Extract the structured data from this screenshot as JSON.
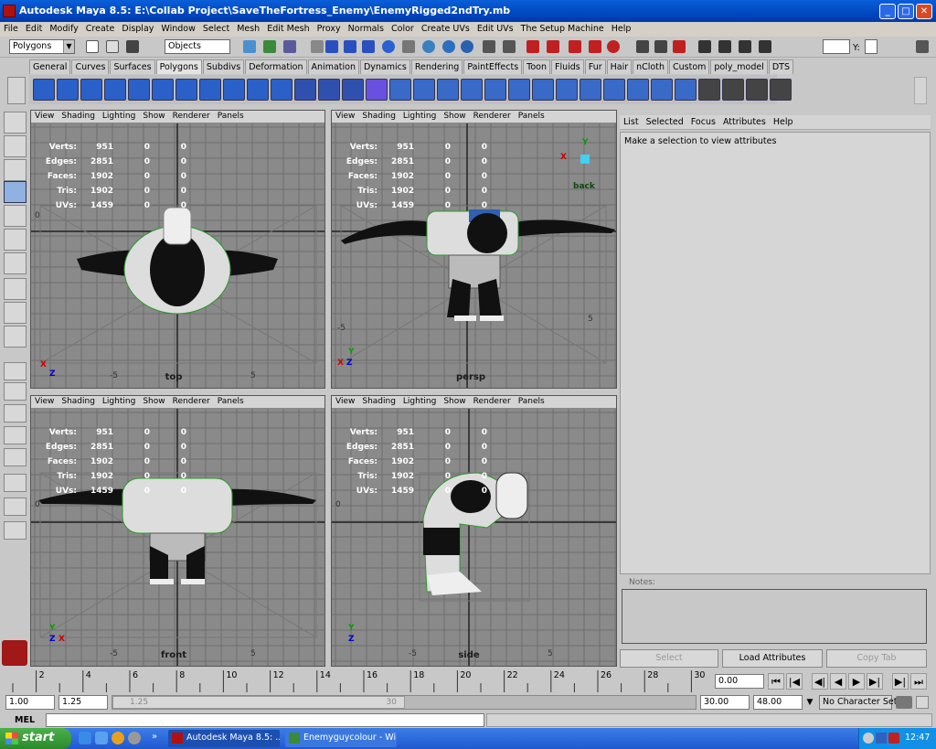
{
  "window": {
    "title": "Autodesk Maya 8.5: E:\\Collab Project\\SaveTheFortress_Enemy\\EnemyRigged2ndTry.mb",
    "min": "_",
    "max": "□",
    "close": "✕"
  },
  "menu": [
    "File",
    "Edit",
    "Modify",
    "Create",
    "Display",
    "Window",
    "Select",
    "Mesh",
    "Edit Mesh",
    "Proxy",
    "Normals",
    "Color",
    "Create UVs",
    "Edit UVs",
    "The Setup Machine",
    "Help"
  ],
  "statusline": {
    "menuset": "Polygons",
    "selmode": "Objects",
    "y_label": "Y:"
  },
  "shelf_tabs": [
    "General",
    "Curves",
    "Surfaces",
    "Polygons",
    "Subdivs",
    "Deformation",
    "Animation",
    "Dynamics",
    "Rendering",
    "PaintEffects",
    "Toon",
    "Fluids",
    "Fur",
    "Hair",
    "nCloth",
    "Custom",
    "poly_model",
    "DTS"
  ],
  "shelf_active": "Polygons",
  "panel_menu": [
    "View",
    "Shading",
    "Lighting",
    "Show",
    "Renderer",
    "Panels"
  ],
  "hud": {
    "labels": [
      "Verts:",
      "Edges:",
      "Faces:",
      "Tris:",
      "UVs:"
    ],
    "values": [
      "951",
      "2851",
      "1902",
      "1902",
      "1459"
    ],
    "zeros": [
      "0",
      "0",
      "0",
      "0",
      "0"
    ],
    "zeros2": [
      "0",
      "0",
      "0",
      "0",
      "0"
    ]
  },
  "viewports": {
    "top": {
      "label": "top",
      "ticks": [
        "-5",
        "0",
        "5"
      ],
      "axis": [
        "X",
        "Z"
      ]
    },
    "persp": {
      "label": "persp",
      "ticks": [
        "-5",
        "5"
      ],
      "axis": [
        "X",
        "Z",
        "Y"
      ],
      "cube": "back"
    },
    "front": {
      "label": "front",
      "ticks": [
        "-5",
        "0",
        "5"
      ],
      "axis": [
        "Z",
        "X",
        "Y"
      ]
    },
    "side": {
      "label": "side",
      "ticks": [
        "-5",
        "0",
        "5"
      ],
      "axis": [
        "Z",
        "Y"
      ]
    }
  },
  "attr": {
    "menu": [
      "List",
      "Selected",
      "Focus",
      "Attributes",
      "Help"
    ],
    "message": "Make a selection to view attributes",
    "notes": "Notes:",
    "buttons": [
      "Select",
      "Load Attributes",
      "Copy Tab"
    ]
  },
  "timeline": {
    "ticks": [
      "2",
      "4",
      "6",
      "8",
      "10",
      "12",
      "14",
      "16",
      "18",
      "20",
      "22",
      "24",
      "26",
      "28",
      "30"
    ],
    "current": "0.00"
  },
  "range": {
    "start": "1.00",
    "inner_start": "1.25",
    "slider_start": "1.25",
    "slider_end": "30",
    "end": "30.00",
    "outer_end": "48.00",
    "charset": "No Character Set"
  },
  "cmd": {
    "label": "MEL"
  },
  "taskbar": {
    "start": "start",
    "tasks": [
      "Autodesk Maya 8.5: ...",
      "Enemyguycolour - Wi..."
    ],
    "clock": "12:47"
  }
}
